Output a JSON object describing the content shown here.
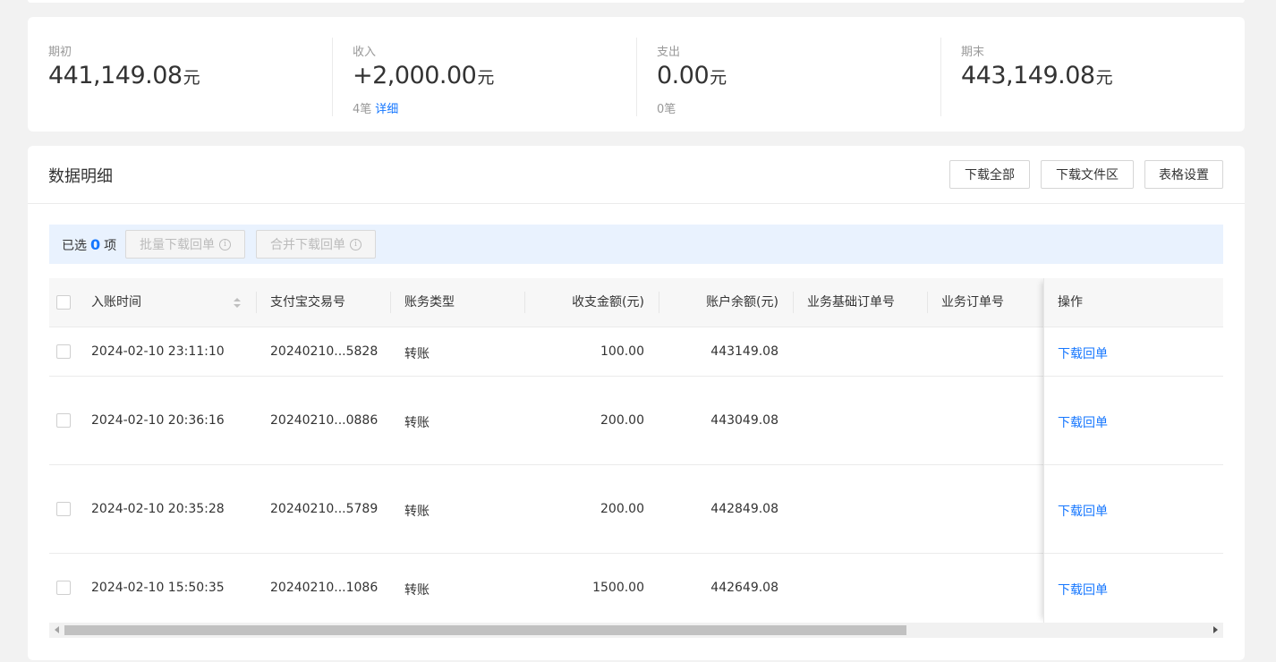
{
  "summary": {
    "opening": {
      "label": "期初",
      "value": "441,149.08",
      "unit": "元"
    },
    "income": {
      "label": "收入",
      "value": "+2,000.00",
      "unit": "元",
      "count": "4笔",
      "detail_link": "详细"
    },
    "expense": {
      "label": "支出",
      "value": "0.00",
      "unit": "元",
      "count": "0笔"
    },
    "closing": {
      "label": "期末",
      "value": "443,149.08",
      "unit": "元"
    }
  },
  "details": {
    "title": "数据明细",
    "buttons": {
      "download_all": "下载全部",
      "download_files": "下载文件区",
      "table_settings": "表格设置"
    },
    "selection": {
      "prefix": "已选",
      "count": "0",
      "suffix": "项",
      "batch_download": "批量下载回单",
      "merge_download": "合并下载回单"
    },
    "columns": {
      "time": "入账时间",
      "trade_no": "支付宝交易号",
      "type": "账务类型",
      "amount": "收支金额(元)",
      "balance": "账户余额(元)",
      "base_order": "业务基础订单号",
      "order": "业务订单号",
      "action": "操作"
    },
    "rows": [
      {
        "time": "2024-02-10 23:11:10",
        "trade_no": "20240210...5828",
        "type": "转账",
        "amount": "100.00",
        "balance": "443149.08",
        "base_order": "",
        "order": "",
        "action": "下载回单"
      },
      {
        "time": "2024-02-10 20:36:16",
        "trade_no": "20240210...0886",
        "type": "转账",
        "amount": "200.00",
        "balance": "443049.08",
        "base_order": "",
        "order": "",
        "action": "下载回单"
      },
      {
        "time": "2024-02-10 20:35:28",
        "trade_no": "20240210...5789",
        "type": "转账",
        "amount": "200.00",
        "balance": "442849.08",
        "base_order": "",
        "order": "",
        "action": "下载回单"
      },
      {
        "time": "2024-02-10 15:50:35",
        "trade_no": "20240210...1086",
        "type": "转账",
        "amount": "1500.00",
        "balance": "442649.08",
        "base_order": "",
        "order": "",
        "action": "下载回单"
      }
    ]
  },
  "colors": {
    "accent": "#1677ff",
    "page_bg": "#f2f2f2",
    "selection_bg": "#e9f2fe"
  }
}
